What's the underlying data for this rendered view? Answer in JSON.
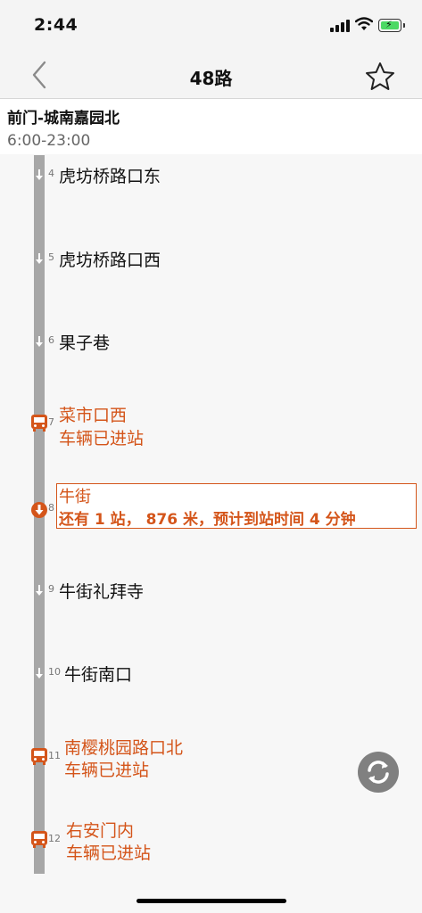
{
  "status": {
    "time": "2:44"
  },
  "nav": {
    "title": "48路",
    "back_icon": "chevron-left-icon",
    "fav_icon": "star-icon"
  },
  "route": {
    "name": "前门-城南嘉园北",
    "hours": "6:00-23:00"
  },
  "stops": [
    {
      "num": "4",
      "name": "虎坊桥路口东"
    },
    {
      "num": "5",
      "name": "虎坊桥路口西"
    },
    {
      "num": "6",
      "name": "果子巷"
    },
    {
      "num": "7",
      "name": "菜市口西",
      "status": "车辆已进站"
    },
    {
      "num": "8",
      "name": "牛街",
      "eta": "还有 1 站， 876 米，预计到站时间 4 分钟"
    },
    {
      "num": "9",
      "name": "牛街礼拜寺"
    },
    {
      "num": "10",
      "name": "牛街南口"
    },
    {
      "num": "11",
      "name": "南樱桃园路口北",
      "status": "车辆已进站"
    },
    {
      "num": "12",
      "name": "右安门内",
      "status": "车辆已进站"
    }
  ],
  "colors": {
    "accent": "#d4551a",
    "rail": "#a7a7a7"
  },
  "refresh_icon": "refresh-icon"
}
